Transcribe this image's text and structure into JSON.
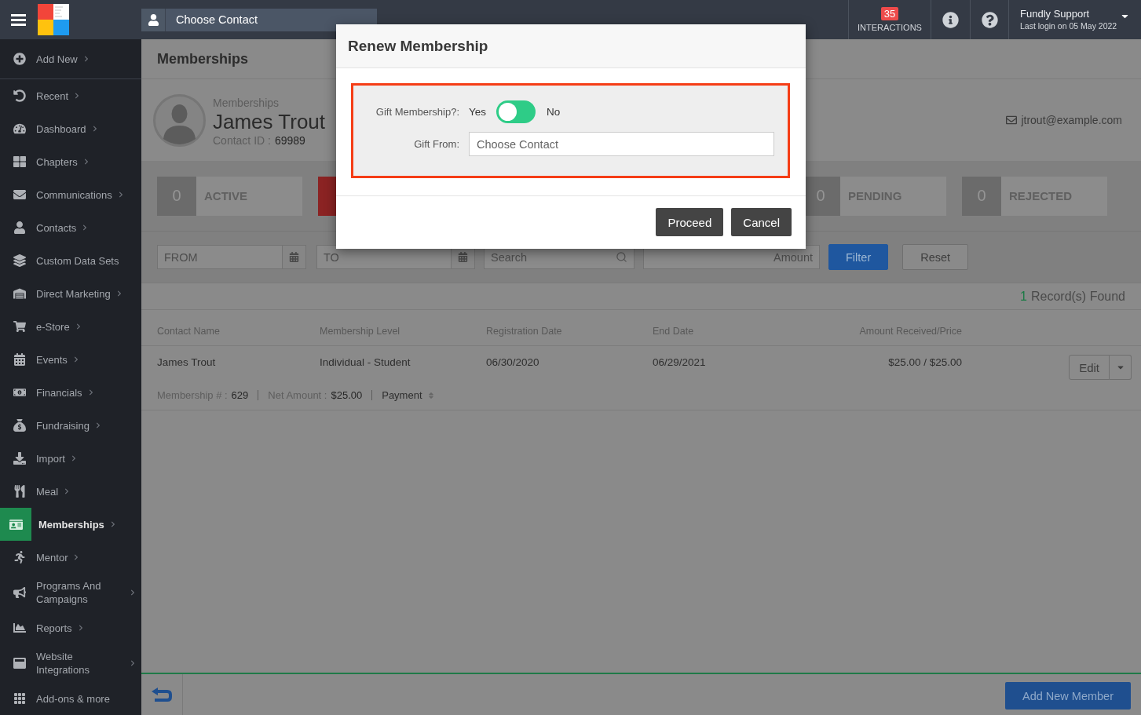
{
  "top_bar": {
    "contact_picker": {
      "placeholder": "Choose Contact"
    },
    "interactions": {
      "count": "35",
      "label": "INTERACTIONS"
    },
    "user": {
      "name": "Fundly Support",
      "last_login": "Last login on 05 May 2022"
    }
  },
  "sidebar": {
    "add_new": {
      "label": "Add New",
      "submenu": true
    },
    "items": [
      {
        "label": "Recent",
        "submenu": true,
        "selected": false
      },
      {
        "label": "Dashboard",
        "submenu": true,
        "selected": false
      },
      {
        "label": "Chapters",
        "submenu": true,
        "selected": false
      },
      {
        "label": "Communications",
        "submenu": true,
        "selected": false
      },
      {
        "label": "Contacts",
        "submenu": true,
        "selected": false
      },
      {
        "label": "Custom Data Sets",
        "submenu": false,
        "selected": false
      },
      {
        "label": "Direct Marketing",
        "submenu": true,
        "selected": false
      },
      {
        "label": "e-Store",
        "submenu": true,
        "selected": false
      },
      {
        "label": "Events",
        "submenu": true,
        "selected": false
      },
      {
        "label": "Financials",
        "submenu": true,
        "selected": false
      },
      {
        "label": "Fundraising",
        "submenu": true,
        "selected": false
      },
      {
        "label": "Import",
        "submenu": true,
        "selected": false
      },
      {
        "label": "Meal",
        "submenu": true,
        "selected": false
      },
      {
        "label": "Memberships",
        "submenu": true,
        "selected": true
      },
      {
        "label": "Mentor",
        "submenu": true,
        "selected": false
      },
      {
        "label": "Programs And Campaigns",
        "submenu": true,
        "selected": false
      },
      {
        "label": "Reports",
        "submenu": true,
        "selected": false
      },
      {
        "label": "Website Integrations",
        "submenu": true,
        "selected": false
      },
      {
        "label": "Add-ons & more",
        "submenu": false,
        "selected": false
      }
    ]
  },
  "page": {
    "title": "Memberships"
  },
  "profile": {
    "section": "Memberships",
    "name": "James Trout",
    "contact_id_label": "Contact ID :",
    "contact_id": "69989",
    "email": "jtrout@example.com"
  },
  "stats": [
    {
      "count": "0",
      "label": "ACTIVE",
      "color": "#6b6b6b"
    },
    {
      "color": "#8b2323"
    },
    {
      "count": "0",
      "label": "PENDING",
      "color": "#6b6b6b"
    },
    {
      "count": "0",
      "label": "REJECTED",
      "color": "#6b6b6b"
    }
  ],
  "filters": {
    "from": {
      "placeholder": "FROM"
    },
    "to": {
      "placeholder": "TO"
    },
    "search": {
      "placeholder": "Search"
    },
    "amount": {
      "placeholder": "Amount"
    },
    "buttons": [
      {
        "label": "Filter",
        "kind": "primary"
      },
      {
        "label": "Reset",
        "kind": "default"
      }
    ]
  },
  "records": {
    "count": "1",
    "label": "Record(s) Found"
  },
  "table": {
    "columns": [
      "Contact Name",
      "Membership Level",
      "Registration Date",
      "End Date",
      "Amount Received/Price"
    ],
    "rows": [
      {
        "cells": [
          "James Trout",
          "Individual - Student",
          "06/30/2020",
          "06/29/2021",
          "$25.00 / $25.00"
        ],
        "action": "Edit",
        "details": [
          {
            "kind": "field",
            "label": "Membership # :",
            "value": "629"
          },
          {
            "kind": "field",
            "label": "Net Amount :",
            "value": "$25.00"
          },
          {
            "kind": "sort",
            "label": "Payment"
          }
        ]
      }
    ]
  },
  "footer": {
    "button": "Add New Member"
  },
  "modal": {
    "title": "Renew Membership",
    "gift_membership": {
      "label": "Gift Membership?:",
      "yes": "Yes",
      "no": "No",
      "no_selected": false
    },
    "gift_from": {
      "label": "Gift From:",
      "placeholder": "Choose Contact"
    },
    "buttons": [
      "Proceed",
      "Cancel"
    ]
  }
}
